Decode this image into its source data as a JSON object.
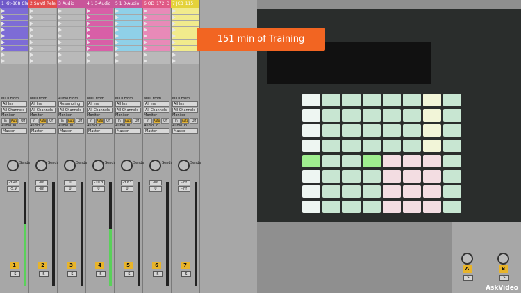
{
  "tracks": [
    {
      "name": "1 Kit-808 Class",
      "color": "#6f58c9",
      "num": "1",
      "v1": "-3.46",
      "v2": "-5.9",
      "clips": "purple"
    },
    {
      "name": "2 Sawtl Rele",
      "color": "#e24d4d",
      "num": "2",
      "v1": "-inf",
      "v2": "-inf",
      "clips": "none"
    },
    {
      "name": "3 Audio",
      "color": "#c8569a",
      "num": "3",
      "v1": "0",
      "v2": "0",
      "clips": "none"
    },
    {
      "name": "4 1 3-Audio",
      "color": "#c8569a",
      "num": "4",
      "v1": "-10.3",
      "v2": "0",
      "clips": "pink"
    },
    {
      "name": "5 1 3-Audio",
      "color": "#c8569a",
      "num": "5",
      "v1": "-3.63",
      "v2": "0",
      "clips": "lightblue"
    },
    {
      "name": "6 OD_172_D",
      "color": "#e05a86",
      "num": "6",
      "v1": "-inf",
      "v2": "0",
      "clips": "pinklight"
    },
    {
      "name": "7 JCB_115_",
      "color": "#e4d23a",
      "num": "7",
      "v1": "-inf",
      "v2": "-inf",
      "clips": "yellow"
    }
  ],
  "labels": {
    "midi_from": "MIDI From",
    "audio_from": "Audio From",
    "all_ins": "All Ins",
    "all_channels": "All Channels",
    "resampling": "Resampling",
    "monitor": "Monitor",
    "in": "In",
    "auto": "Auto",
    "off": "Off",
    "audio_to": "Audio To",
    "master": "Master",
    "sends": "Sends",
    "solo": "S"
  },
  "banner": "151 min of Training",
  "watermark": "AskVideo",
  "return_tracks": [
    {
      "num": "A"
    },
    {
      "num": "B"
    }
  ],
  "colors": {
    "accent": "#f26522",
    "track_num": "#e8b42a",
    "meter": "#5ad15a"
  }
}
